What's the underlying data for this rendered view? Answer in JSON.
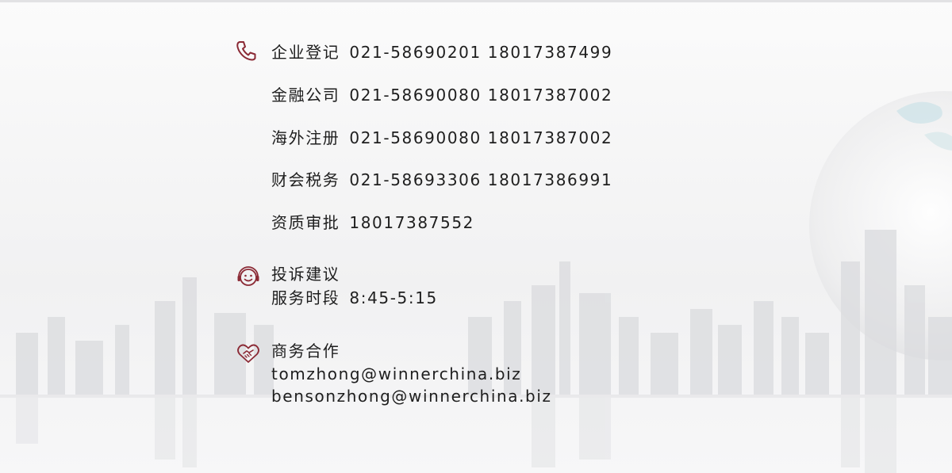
{
  "phone": {
    "icon": "phone-icon",
    "rows": [
      {
        "label": "企业登记",
        "value": "021-58690201 18017387499"
      },
      {
        "label": "金融公司",
        "value": "021-58690080 18017387002"
      },
      {
        "label": "海外注册",
        "value": "021-58690080 18017387002"
      },
      {
        "label": "财会税务",
        "value": "021-58693306 18017386991"
      },
      {
        "label": "资质审批",
        "value": "18017387552"
      }
    ]
  },
  "complaint": {
    "icon": "smiley-headset-icon",
    "title": "投诉建议",
    "hours_label": "服务时段",
    "hours_value": "8:45-5:15"
  },
  "business": {
    "icon": "handshake-heart-icon",
    "title": "商务合作",
    "emails": [
      "tomzhong@winnerchina.biz",
      "bensonzhong@winnerchina.biz"
    ]
  },
  "colors": {
    "accent": "#8b2a35",
    "text": "#1e1e1e"
  }
}
